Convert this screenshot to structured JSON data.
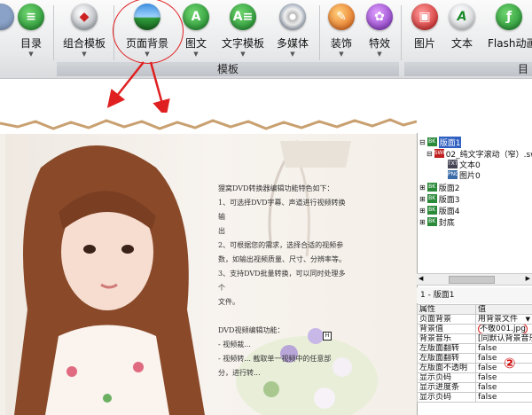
{
  "ribbon": {
    "buttons": [
      {
        "label": "",
        "icon": "edge-icon"
      },
      {
        "label": "目录",
        "icon": "list-icon"
      },
      {
        "label": "组合模板",
        "icon": "combo-icon"
      },
      {
        "label": "页面背景",
        "icon": "landscape-icon"
      },
      {
        "label": "图文",
        "icon": "text-image-icon"
      },
      {
        "label": "文字模板",
        "icon": "text-template-icon"
      },
      {
        "label": "多媒体",
        "icon": "disc-icon"
      },
      {
        "label": "装饰",
        "icon": "feather-icon"
      },
      {
        "label": "特效",
        "icon": "flower-icon"
      },
      {
        "label": "图片",
        "icon": "picture-icon"
      },
      {
        "label": "文本",
        "icon": "text-icon"
      },
      {
        "label": "Flash动画",
        "icon": "flash-icon"
      }
    ],
    "group_label": "模板",
    "group_label_right": "目"
  },
  "canvas": {
    "text_lines": [
      "狸窝DVD转换器编辑功能特色如下：",
      "1、可选择DVD字幕、声道进行视频转换输",
      "出",
      "2、可根据您的需求，选择合适的视频参",
      "数，如输出视频质量、尺寸、分辨率等。",
      "3、支持DVD批量转换，可以同时处理多个",
      "文件。",
      "",
      "DVD视频编辑功能：",
      "- 视频裁...",
      "- 视频转... 截取单一视频中的任意部",
      "分，进行转..."
    ]
  },
  "tree": {
    "items": [
      {
        "label": "版面1",
        "icon": "page-icon",
        "selected": true
      },
      {
        "label": "02_纯文字滚动（窄）.sw",
        "icon": "swf-icon"
      },
      {
        "label": "文本0",
        "icon": "text-node-icon"
      },
      {
        "label": "图片0",
        "icon": "image-node-icon"
      },
      {
        "label": "版面2",
        "icon": "page-icon"
      },
      {
        "label": "版面3",
        "icon": "page-icon"
      },
      {
        "label": "版面4",
        "icon": "page-icon"
      },
      {
        "label": "封底",
        "icon": "page-icon"
      }
    ]
  },
  "properties": {
    "title": "1 - 版面1",
    "header": {
      "name": "属性",
      "value": "值"
    },
    "rows": [
      {
        "name": "页面背景",
        "value": "用背景文件"
      },
      {
        "name": "背景值",
        "value": "不敬001.jpg"
      },
      {
        "name": "背景音乐",
        "value": "[同默认背景音乐"
      },
      {
        "name": "左版面翻转",
        "value": "false"
      },
      {
        "name": "左版面翻转",
        "value": "false"
      },
      {
        "name": "左版面不透明",
        "value": "false"
      },
      {
        "name": "显示页码",
        "value": "false"
      },
      {
        "name": "显示进度条",
        "value": "false"
      },
      {
        "name": "显示页码",
        "value": "false"
      }
    ]
  },
  "annotation": {
    "number": "②"
  },
  "colors": {
    "accent": "#e02020"
  }
}
